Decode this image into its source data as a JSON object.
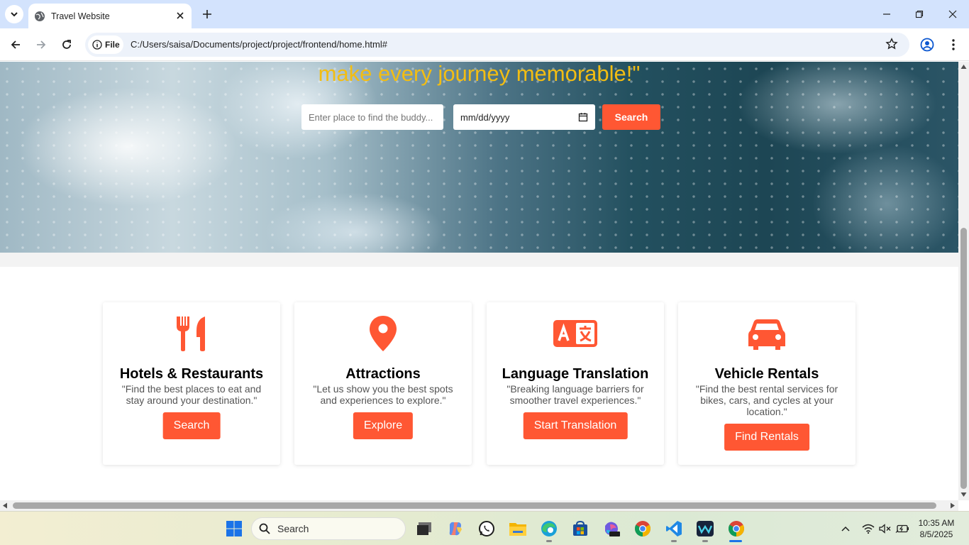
{
  "browser": {
    "tab_title": "Travel Website",
    "chip_label": "File",
    "url": "C:/Users/saisa/Documents/project/project/frontend/home.html#"
  },
  "hero": {
    "title": "make every journey memorable!\"",
    "place_placeholder": "Enter place to find the buddy...",
    "date_value": "mm/dd/yyyy",
    "search_label": "Search"
  },
  "cards": [
    {
      "icon": "utensils-icon",
      "title": "Hotels & Restaurants",
      "desc": "\"Find the best places to eat and stay around your destination.\"",
      "button": "Search"
    },
    {
      "icon": "map-pin-icon",
      "title": "Attractions",
      "desc": "\"Let us show you the best spots and experiences to explore.\"",
      "button": "Explore"
    },
    {
      "icon": "translate-icon",
      "title": "Language Translation",
      "desc": "\"Breaking language barriers for smoother travel experiences.\"",
      "button": "Start Translation"
    },
    {
      "icon": "car-icon",
      "title": "Vehicle Rentals",
      "desc": "\"Find the best rental services for bikes, cars, and cycles at your location.\"",
      "button": "Find Rentals"
    }
  ],
  "taskbar": {
    "search_label": "Search",
    "time": "10:35 AM",
    "date": "8/5/2025"
  },
  "colors": {
    "accent": "#ff5733",
    "hero_title": "#f2bd13"
  }
}
